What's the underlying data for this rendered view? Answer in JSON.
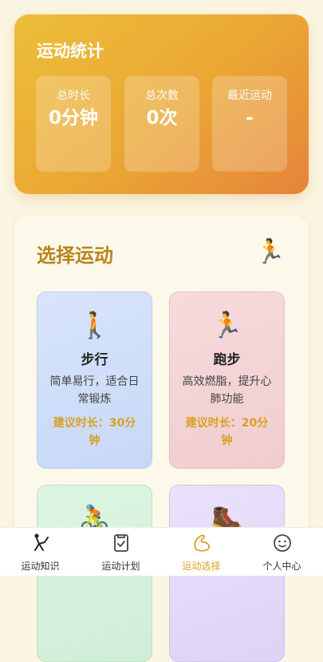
{
  "stats": {
    "title": "运动统计",
    "items": [
      {
        "label": "总时长",
        "value": "0分钟"
      },
      {
        "label": "总次数",
        "value": "0次"
      },
      {
        "label": "最近运动",
        "value": "-"
      }
    ]
  },
  "select": {
    "title": "选择运动",
    "header_icon": "🏃",
    "sports": [
      {
        "icon": "🚶",
        "name": "步行",
        "desc": "简单易行，适合日常锻炼",
        "suggest": "建议时长：30分钟"
      },
      {
        "icon": "🏃",
        "name": "跑步",
        "desc": "高效燃脂，提升心肺功能",
        "suggest": "建议时长：20分钟"
      },
      {
        "icon": "🚴",
        "name": "",
        "desc": "",
        "suggest": ""
      },
      {
        "icon": "🥾",
        "name": "",
        "desc": "",
        "suggest": ""
      }
    ]
  },
  "tabbar": {
    "tabs": [
      {
        "label": "运动知识",
        "icon": "exercise-icon"
      },
      {
        "label": "运动计划",
        "icon": "plan-icon"
      },
      {
        "label": "运动选择",
        "icon": "muscle-icon",
        "active": true
      },
      {
        "label": "个人中心",
        "icon": "profile-icon"
      }
    ],
    "active_color": "#d9a024"
  }
}
